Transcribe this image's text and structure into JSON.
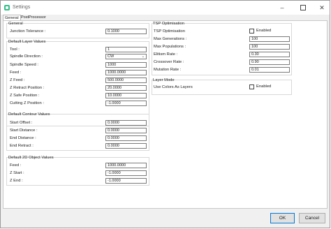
{
  "window": {
    "title": "Settings"
  },
  "tabs": [
    {
      "label": "General"
    },
    {
      "label": "PostProcessor"
    }
  ],
  "general_group": {
    "title": "General",
    "rows": [
      {
        "label": "Junction Tolerance :",
        "value": "0.1000"
      }
    ]
  },
  "layer_group": {
    "title": "Default Layer Values",
    "tool": {
      "label": "Tool :",
      "value": "1"
    },
    "spindle_direction": {
      "label": "Spindle Direction :",
      "value": "CW"
    },
    "rows": [
      {
        "label": "Spindle Speed :",
        "value": "1000"
      },
      {
        "label": "Feed :",
        "value": "1000.0000"
      },
      {
        "label": "Z Feed :",
        "value": "500.0000"
      },
      {
        "label": "Z Retract Position :",
        "value": "20.0000"
      },
      {
        "label": "Z Safe Position :",
        "value": "10.0000"
      },
      {
        "label": "Cutting Z Position :",
        "value": "-1.0000"
      }
    ]
  },
  "contour_group": {
    "title": "Default Contour Values",
    "rows": [
      {
        "label": "Start Offset :",
        "value": "0.0000"
      },
      {
        "label": "Start Distance :",
        "value": "0.0000"
      },
      {
        "label": "End Distance :",
        "value": "0.0000"
      },
      {
        "label": "End Retract :",
        "value": "0.0000"
      }
    ]
  },
  "object2d_group": {
    "title": "Default 2D Object Values",
    "rows": [
      {
        "label": "Feed :",
        "value": "1000.0000"
      },
      {
        "label": "Z Start :",
        "value": "-1.0000"
      },
      {
        "label": "Z End :",
        "value": "-1.0000"
      }
    ]
  },
  "tsp_group": {
    "title": "TSP Optimisation",
    "enable": {
      "label": "TSP Optimisation",
      "checkbox_label": "Enabled",
      "checked": false
    },
    "rows": [
      {
        "label": "Max Generations :",
        "value": "100"
      },
      {
        "label": "Max Populations :",
        "value": "100"
      },
      {
        "label": "Elitism Rate :",
        "value": "0.30"
      },
      {
        "label": "Crossover Rate :",
        "value": "0.90"
      },
      {
        "label": "Mutation Rate :",
        "value": "0.01"
      }
    ]
  },
  "layer_mode_group": {
    "title": "Layer Mode",
    "use_colors": {
      "label": "Use Colors As Layers",
      "checkbox_label": "Enabled",
      "checked": false
    }
  },
  "buttons": {
    "ok": "OK",
    "cancel": "Cancel"
  }
}
